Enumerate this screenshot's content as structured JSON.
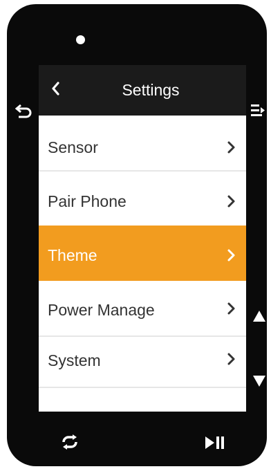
{
  "header": {
    "title": "Settings",
    "back_icon": "chevron-left-icon"
  },
  "menu": {
    "items": [
      {
        "label": "Sensor",
        "icon": "chevron-right-icon",
        "selected": false
      },
      {
        "label": "Pair Phone",
        "icon": "chevron-right-icon",
        "selected": false
      },
      {
        "label": "Theme",
        "icon": "chevron-right-icon",
        "selected": true
      },
      {
        "label": "Power Manage",
        "icon": "chevron-right-icon",
        "selected": false
      },
      {
        "label": "System",
        "icon": "chevron-right-icon",
        "selected": false
      }
    ]
  },
  "hardware_buttons": {
    "left": "back-arrow-icon",
    "right_top": "menu-enter-icon",
    "up": "arrow-up-icon",
    "down": "arrow-down-icon",
    "bottom_left": "loop-icon",
    "bottom_right": "play-pause-icon"
  },
  "colors": {
    "bezel": "#0a0a0a",
    "header": "#1b1b1b",
    "selected": "#f29c1f",
    "text": "#333333"
  }
}
